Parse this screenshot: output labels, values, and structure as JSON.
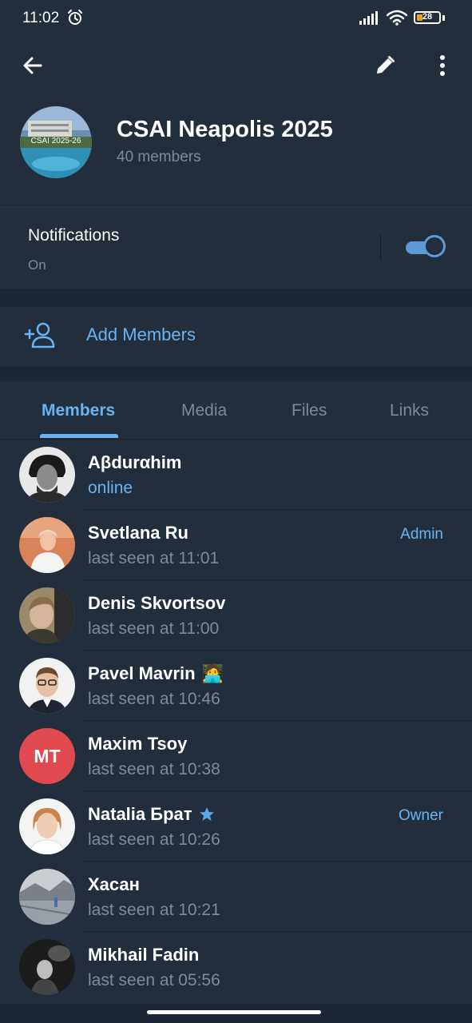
{
  "status_bar": {
    "time": "11:02",
    "battery": "28",
    "battery_level": 0.28,
    "icons": [
      "alarm-icon",
      "signal-icon",
      "wifi-icon",
      "battery-icon"
    ]
  },
  "header": {
    "avatar_text": "CSAI 2025-26",
    "title": "CSAI Neapolis 2025",
    "subtitle": "40 members",
    "icons": [
      "back-arrow-icon",
      "pencil-icon",
      "more-vertical-icon"
    ]
  },
  "notifications": {
    "label": "Notifications",
    "status": "On",
    "enabled": true
  },
  "add_members": {
    "label": "Add Members",
    "icon": "add-user-icon"
  },
  "tabs": [
    {
      "label": "Members",
      "active": true
    },
    {
      "label": "Media",
      "active": false
    },
    {
      "label": "Files",
      "active": false
    },
    {
      "label": "Links",
      "active": false
    }
  ],
  "members": [
    {
      "name": "Aβdurαhim",
      "status": "online",
      "role": "",
      "emoji": ""
    },
    {
      "name": "Svetlana Ru",
      "status": "last seen at 11:01",
      "role": "Admin",
      "emoji": ""
    },
    {
      "name": "Denis Skvortsov",
      "status": "last seen at 11:00",
      "role": "",
      "emoji": ""
    },
    {
      "name": "Pavel Mavrin",
      "status": "last seen at 10:46",
      "role": "",
      "emoji": "🧑‍💻"
    },
    {
      "name": "Maxim Tsoy",
      "status": "last seen at 10:38",
      "role": "",
      "initials": "MT",
      "emoji": ""
    },
    {
      "name": "Natalia Брат",
      "status": "last seen at 10:26",
      "role": "Owner",
      "emoji": ""
    },
    {
      "name": "Хасан",
      "status": "last seen at 10:21",
      "role": "",
      "emoji": ""
    },
    {
      "name": "Mikhail Fadin",
      "status": "last seen at 05:56",
      "role": "",
      "emoji": ""
    }
  ],
  "colors": {
    "background": "#1d2733",
    "surface": "#232e3c",
    "accent": "#6ab3f3",
    "secondary_text": "#7d8b99",
    "avatar_red": "#e0494f",
    "battery": "#f0a021"
  }
}
